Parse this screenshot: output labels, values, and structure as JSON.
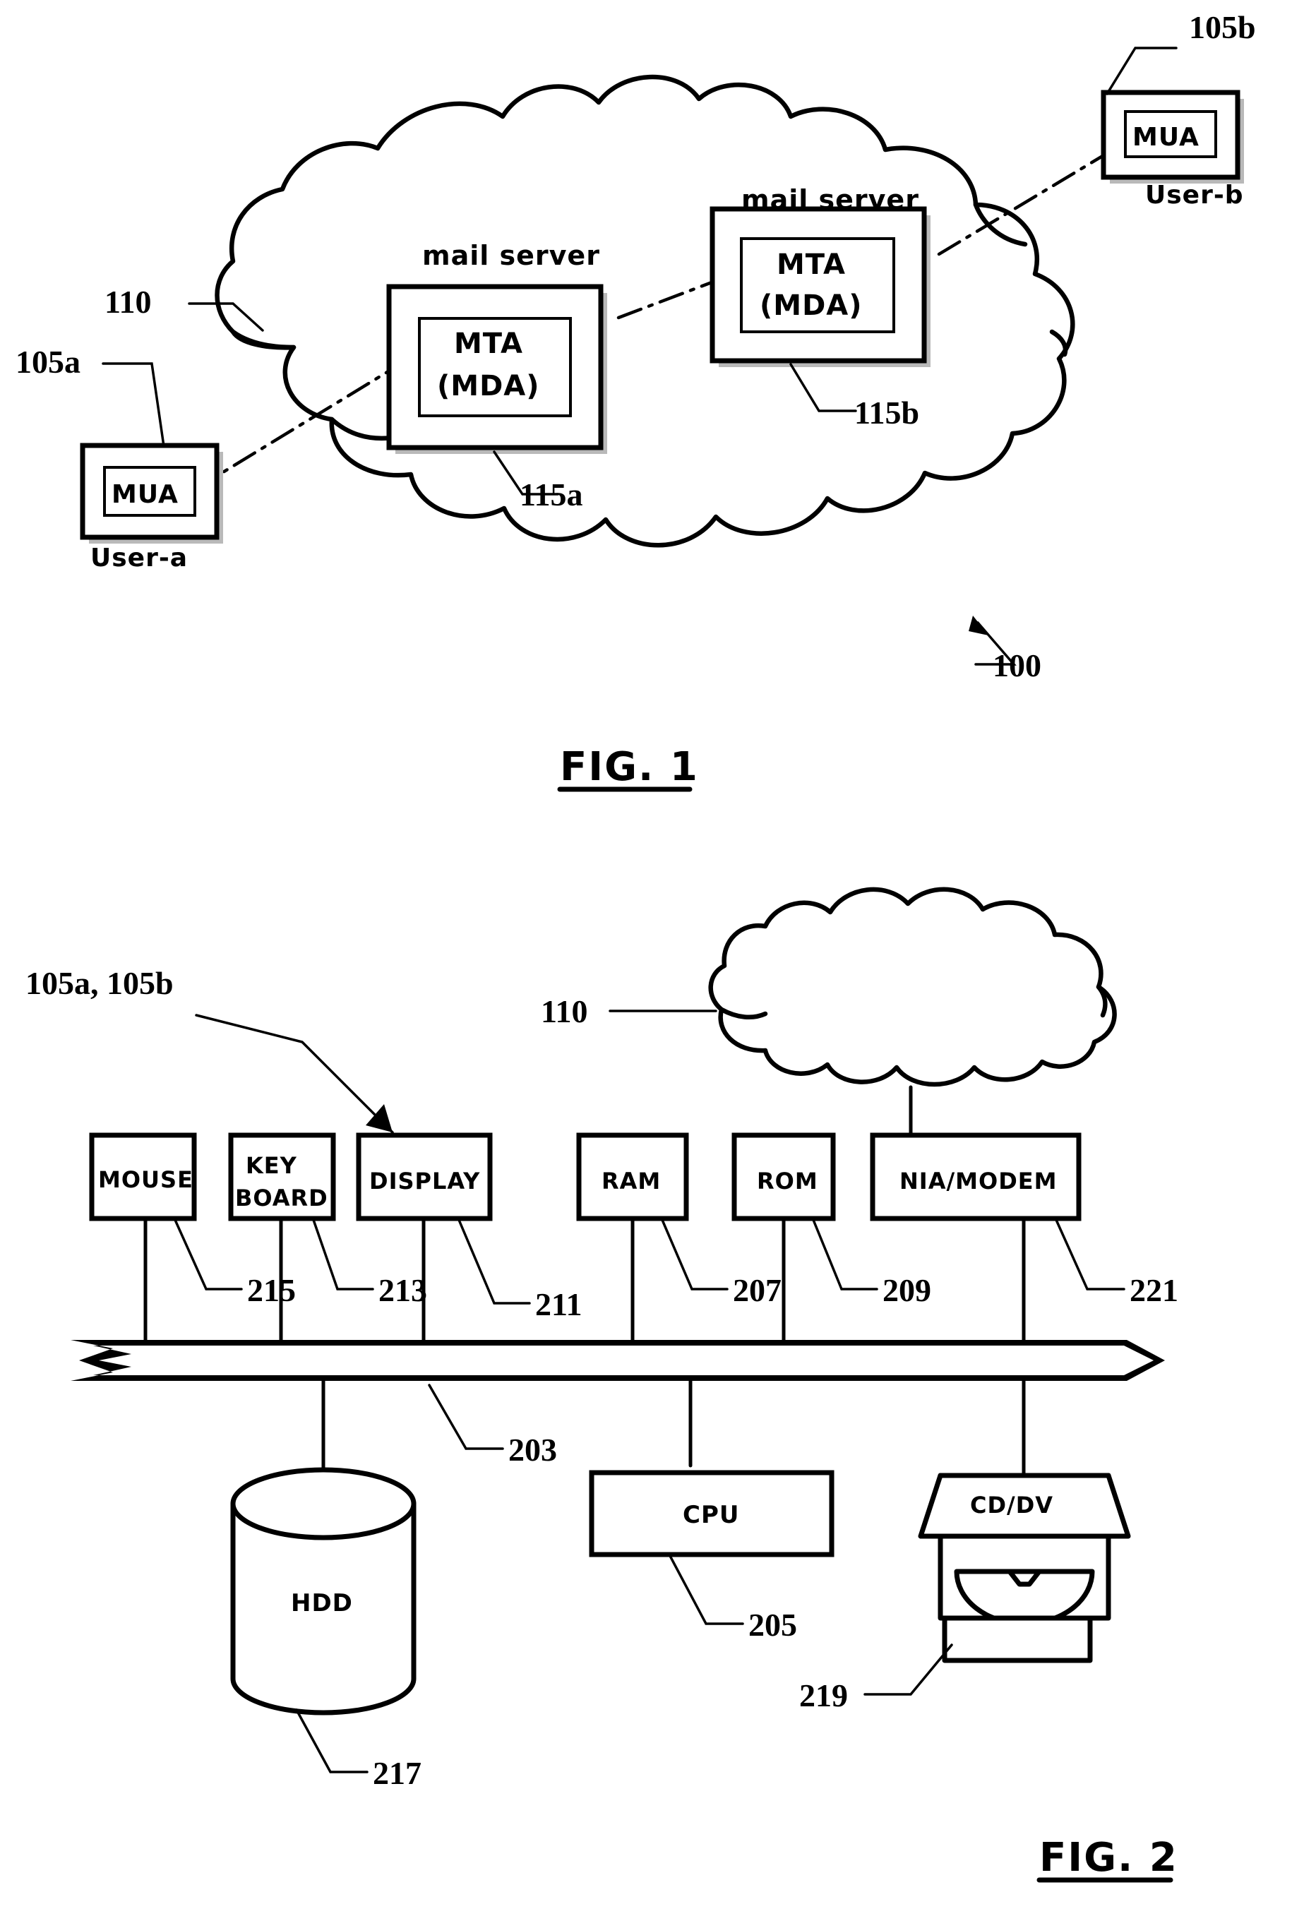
{
  "document": {
    "type": "patent-drawing-sheet",
    "figures": [
      "FIG. 1",
      "FIG. 2"
    ]
  },
  "fig1": {
    "caption": "FIG. 1",
    "system_ref": "100",
    "network": {
      "ref": "110",
      "shape": "cloud"
    },
    "clients": [
      {
        "ref": "105a",
        "box_label": "MUA",
        "user_label": "User-a",
        "side": "left"
      },
      {
        "ref": "105b",
        "box_label": "MUA",
        "user_label": "User-b",
        "side": "right"
      }
    ],
    "servers": [
      {
        "ref": "115a",
        "title": "mail server",
        "inner_line1": "MTA",
        "inner_line2": "(MDA)"
      },
      {
        "ref": "115b",
        "title": "mail server",
        "inner_line1": "MTA",
        "inner_line2": "(MDA)"
      }
    ],
    "link_style": "dash-dot"
  },
  "fig2": {
    "caption": "FIG. 2",
    "client_ref": "105a, 105b",
    "network": {
      "ref": "110",
      "shape": "cloud"
    },
    "bus": {
      "ref": "203",
      "style": "broken-arrow-band"
    },
    "top_components": [
      {
        "ref": "215",
        "label": "MOUSE",
        "lines": [
          "MOUSE"
        ]
      },
      {
        "ref": "213",
        "label": "KEY BOARD",
        "lines": [
          "KEY",
          "BOARD"
        ]
      },
      {
        "ref": "211",
        "label": "DISPLAY",
        "lines": [
          "DISPLAY"
        ]
      },
      {
        "ref": "207",
        "label": "RAM",
        "lines": [
          "RAM"
        ]
      },
      {
        "ref": "209",
        "label": "ROM",
        "lines": [
          "ROM"
        ]
      },
      {
        "ref": "221",
        "label": "NIA/MODEM",
        "lines": [
          "NIA/MODEM"
        ]
      }
    ],
    "bottom_components": [
      {
        "ref": "217",
        "label": "HDD",
        "shape": "cylinder"
      },
      {
        "ref": "205",
        "label": "CPU",
        "shape": "rectangle"
      },
      {
        "ref": "219",
        "label": "CD/DV",
        "shape": "optical-drive"
      }
    ]
  },
  "colors": {
    "ink": "#000000",
    "paper": "#ffffff",
    "shadow": "#b9b9b9"
  }
}
